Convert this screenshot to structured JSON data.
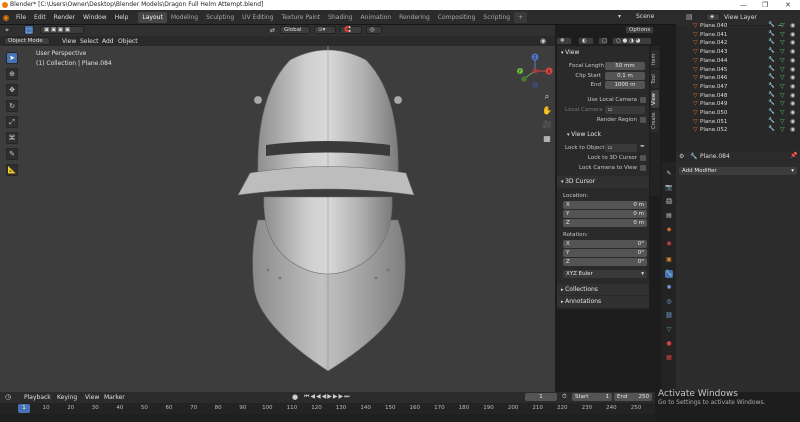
{
  "window": {
    "title": "Blender* [C:\\Users\\Owner\\Desktop\\Blender Models\\Dragon Full Helm Attempt.blend]",
    "controls": [
      "—",
      "❐",
      "✕"
    ]
  },
  "menu": [
    "File",
    "Edit",
    "Render",
    "Window",
    "Help"
  ],
  "workspaces": {
    "tabs": [
      "Layout",
      "Modeling",
      "Sculpting",
      "UV Editing",
      "Texture Paint",
      "Shading",
      "Animation",
      "Rendering",
      "Compositing",
      "Scripting"
    ],
    "active": "Layout",
    "add": "+"
  },
  "scene": {
    "label": "Scene",
    "view_layer": "View Layer"
  },
  "viewport": {
    "mode": "Object Mode",
    "menus": [
      "View",
      "Select",
      "Add",
      "Object"
    ],
    "orientation": "Global",
    "options": "Options",
    "overlay_line1": "User Perspective",
    "overlay_line2": "(1) Collection | Plane.084",
    "gizmo": {
      "x": "X",
      "y": "Y",
      "z": "Z"
    }
  },
  "npanel": {
    "tabs": [
      "Item",
      "Tool",
      "View",
      "Create"
    ],
    "active_tab": "View",
    "view": {
      "header": "View",
      "focal_length_label": "Focal Length",
      "focal_length": "50 mm",
      "clip_start_label": "Clip Start",
      "clip_start": "0.1 m",
      "end_label": "End",
      "end": "1000 m",
      "use_local_camera": "Use Local Camera",
      "local_camera": "Local Camera",
      "render_region": "Render Region"
    },
    "view_lock": {
      "header": "View Lock",
      "lock_to_object": "Lock to Object",
      "lock_to_cursor": "Lock to 3D Cursor",
      "lock_camera": "Lock Camera to View"
    },
    "cursor": {
      "header": "3D Cursor",
      "location_label": "Location:",
      "location": [
        {
          "axis": "X",
          "value": "0 m"
        },
        {
          "axis": "Y",
          "value": "0 m"
        },
        {
          "axis": "Z",
          "value": "0 m"
        }
      ],
      "rotation_label": "Rotation:",
      "rotation": [
        {
          "axis": "X",
          "value": "0°"
        },
        {
          "axis": "Y",
          "value": "0°"
        },
        {
          "axis": "Z",
          "value": "0°"
        }
      ],
      "rotation_mode": "XYZ Euler"
    },
    "collections": "Collections",
    "annotations": "Annotations"
  },
  "outliner": {
    "items": [
      "Plane.040",
      "Plane.041",
      "Plane.042",
      "Plane.043",
      "Plane.044",
      "Plane.045",
      "Plane.046",
      "Plane.047",
      "Plane.048",
      "Plane.049",
      "Plane.050",
      "Plane.051",
      "Plane.052"
    ]
  },
  "properties": {
    "object_name": "Plane.084",
    "add_modifier": "Add Modifier"
  },
  "timeline": {
    "menus": [
      "Playback",
      "Keying",
      "View",
      "Marker"
    ],
    "current_frame": "1",
    "start_label": "Start",
    "start": "1",
    "end_label": "End",
    "end": "250",
    "ticks": [
      "1",
      "10",
      "20",
      "30",
      "40",
      "50",
      "60",
      "70",
      "80",
      "90",
      "100",
      "110",
      "120",
      "130",
      "140",
      "150",
      "160",
      "170",
      "180",
      "190",
      "200",
      "210",
      "220",
      "230",
      "240",
      "250"
    ]
  },
  "watermark": {
    "title": "Activate Windows",
    "subtitle": "Go to Settings to activate Windows."
  },
  "colors": {
    "accent": "#4772b3",
    "viewport_bg": "#3d3d3d",
    "object_orange": "#e06a2a",
    "mesh_green": "#56c266"
  }
}
